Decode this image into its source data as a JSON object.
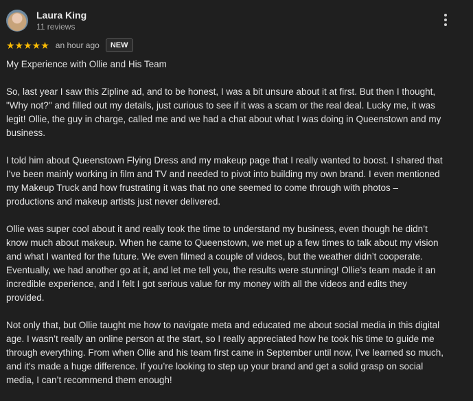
{
  "review": {
    "author_name": "Laura King",
    "author_meta": "11 reviews",
    "stars": "★★★★★",
    "rating": 5,
    "time": "an hour ago",
    "badge": "NEW",
    "paragraphs": [
      "My Experience with Ollie and His Team",
      "So, last year I saw this Zipline ad, and to be honest, I was a bit unsure about it at first. But then I thought, \"Why not?\" and filled out my details, just curious to see if it was a scam or the real deal. Lucky me, it was legit! Ollie, the guy in charge, called me and we had a chat about what I was doing in Queenstown and my business.",
      "I told him about Queenstown Flying Dress and my makeup page that I really wanted to boost. I shared that I’ve been mainly working in film and TV and needed to pivot into building my own brand. I even mentioned my Makeup Truck and how frustrating it was that no one seemed to come through with photos – productions and makeup artists just never delivered.",
      "Ollie was super cool about it and really took the time to understand my business, even though he didn’t know much about makeup. When he came to Queenstown, we met up a few times to talk about my vision and what I wanted for the future. We even filmed a couple of videos, but the weather didn’t cooperate. Eventually, we had another go at it, and let me tell you, the results were stunning! Ollie’s team made it an incredible experience, and I felt I got serious value for my money with all the videos and edits they provided.",
      "Not only that, but Ollie taught me how to navigate meta and educated me about social media in this digital age. I wasn’t really an online person at the start, so I really appreciated how he took his time to guide me through everything. From when Ollie and his team first came in September until now, I’ve learned so much, and it's made a huge difference. If you’re looking to step up your brand and get a solid grasp on social media, I can’t recommend them enough!"
    ]
  },
  "icons": {
    "avatar": "avatar",
    "more": "more-vert-icon"
  },
  "colors": {
    "background": "#1f1f1f",
    "stars": "#fbbc04",
    "text": "#e3e3e3"
  }
}
